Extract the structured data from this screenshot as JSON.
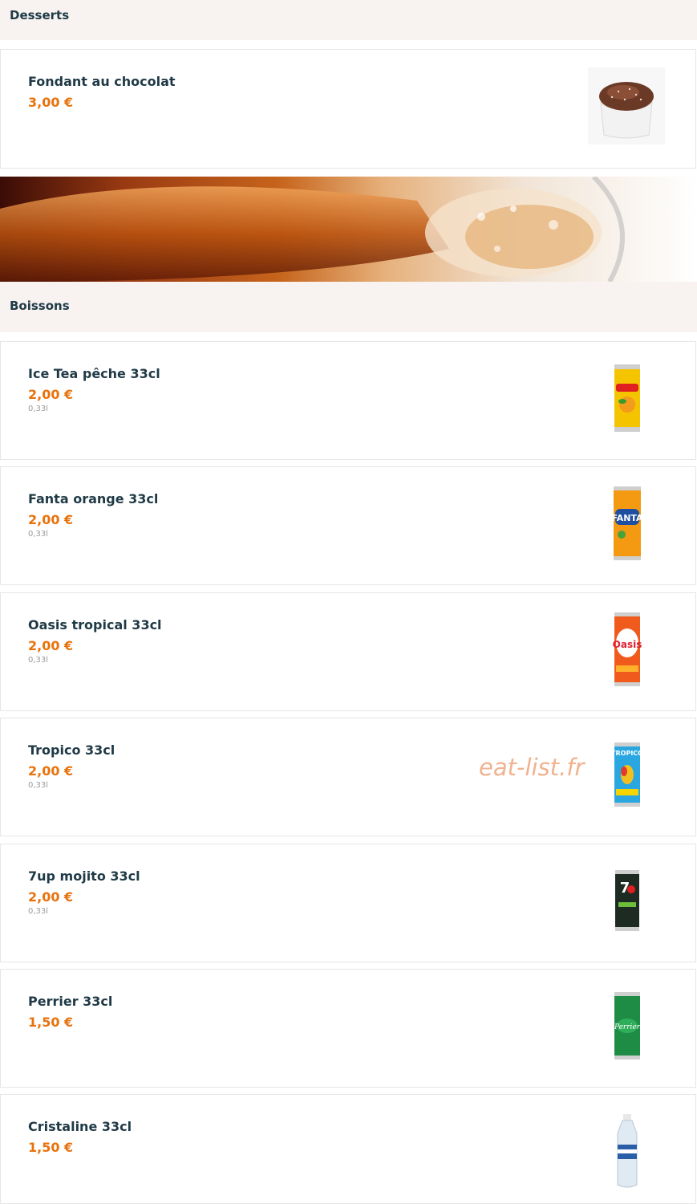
{
  "sections": {
    "desserts": {
      "title": "Desserts"
    },
    "drinks": {
      "title": "Boissons"
    }
  },
  "desserts_items": [
    {
      "name": "Fondant au chocolat",
      "price": "3,00 €",
      "image": "chocolate-fondant"
    }
  ],
  "drinks_items": [
    {
      "name": "Ice Tea pêche 33cl",
      "price": "2,00 €",
      "volume": "0,33l",
      "image": "lipton-can"
    },
    {
      "name": "Fanta orange 33cl",
      "price": "2,00 €",
      "volume": "0,33l",
      "image": "fanta-can"
    },
    {
      "name": "Oasis tropical 33cl",
      "price": "2,00 €",
      "volume": "0,33l",
      "image": "oasis-can"
    },
    {
      "name": "Tropico 33cl",
      "price": "2,00 €",
      "volume": "0,33l",
      "image": "tropico-can"
    },
    {
      "name": "7up mojito 33cl",
      "price": "2,00 €",
      "volume": "0,33l",
      "image": "7up-can"
    },
    {
      "name": "Perrier 33cl",
      "price": "1,50 €",
      "image": "perrier-can"
    },
    {
      "name": "Cristaline 33cl",
      "price": "1,50 €",
      "image": "water-bottle"
    }
  ],
  "watermark": "eat-list.fr",
  "colors": {
    "header_bg": "#f8f3f1",
    "title": "#1f3a46",
    "price": "#e8720c"
  }
}
